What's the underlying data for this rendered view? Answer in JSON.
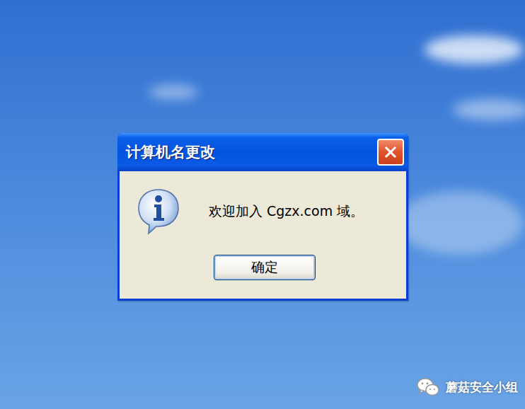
{
  "desktop": {
    "watermark": {
      "text": "蘑菇安全小组"
    }
  },
  "dialog": {
    "title": "计算机名更改",
    "message": "欢迎加入 Cgzx.com 域。",
    "buttons": [
      {
        "label": "确定",
        "default": true
      }
    ]
  }
}
